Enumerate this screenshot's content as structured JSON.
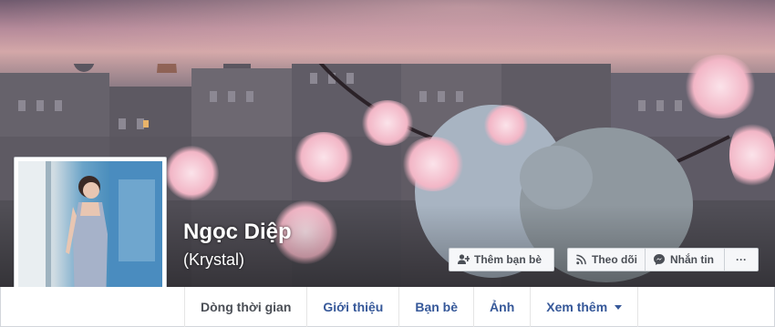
{
  "profile": {
    "name": "Ngọc Diệp",
    "alternate_name": "(Krystal)"
  },
  "actions": {
    "add_friend": "Thêm bạn bè",
    "follow": "Theo dõi",
    "message": "Nhắn tin",
    "more": "···"
  },
  "tabs": [
    {
      "label": "Dòng thời gian",
      "active": true
    },
    {
      "label": "Giới thiệu"
    },
    {
      "label": "Bạn bè"
    },
    {
      "label": "Ảnh"
    },
    {
      "label": "Xem thêm"
    }
  ],
  "colors": {
    "link": "#365899",
    "button_text": "#4b4f56",
    "button_bg": "#f6f7f9"
  }
}
